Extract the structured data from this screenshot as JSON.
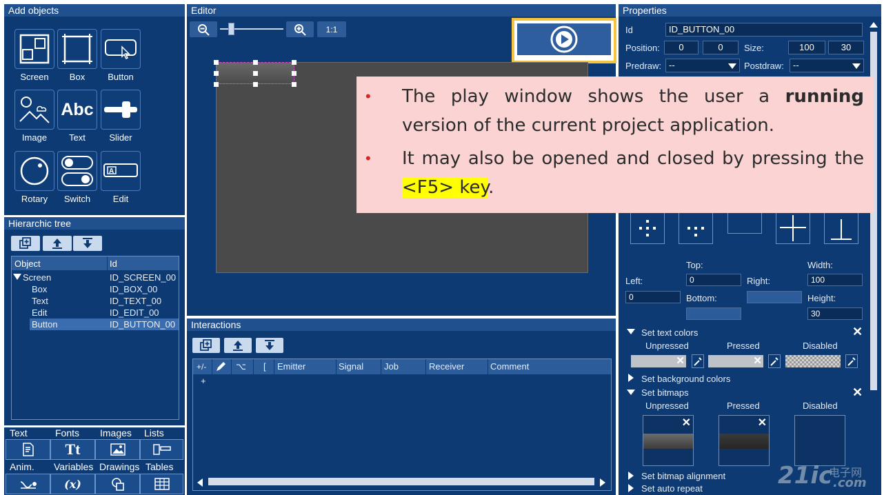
{
  "add_objects": {
    "title": "Add objects",
    "items": [
      {
        "label": "Screen",
        "icon": "screen-icon"
      },
      {
        "label": "Box",
        "icon": "box-icon"
      },
      {
        "label": "Button",
        "icon": "button-icon"
      },
      {
        "label": "Image",
        "icon": "image-icon"
      },
      {
        "label": "Text",
        "icon": "text-icon"
      },
      {
        "label": "Slider",
        "icon": "slider-icon"
      },
      {
        "label": "Rotary",
        "icon": "rotary-icon"
      },
      {
        "label": "Switch",
        "icon": "switch-icon"
      },
      {
        "label": "Edit",
        "icon": "edit-icon"
      }
    ]
  },
  "hierarchic_tree": {
    "title": "Hierarchic tree",
    "columns": [
      "Object",
      "Id"
    ],
    "rows": [
      {
        "object": "Screen",
        "id": "ID_SCREEN_00"
      },
      {
        "object": "Box",
        "id": "ID_BOX_00"
      },
      {
        "object": "Text",
        "id": "ID_TEXT_00"
      },
      {
        "object": "Edit",
        "id": "ID_EDIT_00"
      },
      {
        "object": "Button",
        "id": "ID_BUTTON_00"
      }
    ]
  },
  "bottom_tabs": {
    "row1": [
      "Text",
      "Fonts",
      "Images",
      "Lists"
    ],
    "row2": [
      "Anim.",
      "Variables",
      "Drawings",
      "Tables"
    ],
    "icon_text": "Tt",
    "icon_x": "(x)"
  },
  "editor": {
    "title": "Editor",
    "zoom_reset_label": "1:1",
    "zoom_level": 0.15
  },
  "interactions": {
    "title": "Interactions",
    "columns": [
      "+/-",
      "",
      "⌥",
      "[",
      "Emitter",
      "Signal",
      "Job",
      "Receiver",
      "Comment"
    ],
    "add_row": "+"
  },
  "properties": {
    "title": "Properties",
    "id_label": "Id",
    "id_value": "ID_BUTTON_00",
    "position_label": "Position:",
    "pos_x": "0",
    "pos_y": "0",
    "size_label": "Size:",
    "size_w": "100",
    "size_h": "30",
    "predraw_label": "Predraw:",
    "predraw_value": "--",
    "postdraw_label": "Postdraw:",
    "postdraw_value": "--",
    "top_label": "Top:",
    "width_label": "Width:",
    "left_label": "Left:",
    "top_value": "0",
    "right_label": "Right:",
    "width_value": "100",
    "left_value": "0",
    "bottom_label": "Bottom:",
    "height_label": "Height:",
    "height_value": "30",
    "text_colors_label": "Set text colors",
    "unpressed": "Unpressed",
    "pressed": "Pressed",
    "disabled": "Disabled",
    "bg_colors_label": "Set background colors",
    "bitmaps_label": "Set bitmaps",
    "bitmap_alignment_label": "Set bitmap alignment",
    "auto_repeat_label": "Set auto repeat"
  },
  "callout": {
    "bullet1_pre": "The play window shows the user a ",
    "bullet1_bold": "running",
    "bullet1_post": " version of the current project application.",
    "bullet2_pre": "It may also be opened and closed by pressing the ",
    "bullet2_highlight": "<F5> key",
    "bullet2_post": "."
  },
  "watermark": {
    "brand": "21ic",
    "cn": "电子网",
    "domain": ".com"
  },
  "colors": {
    "panel_bg": "#0d3a72",
    "title_bar": "#20508e",
    "callout_bg": "#fbd3d3",
    "bullet_red": "#e02020",
    "highlight_yellow": "#ffff00",
    "play_border": "#f5c342"
  }
}
